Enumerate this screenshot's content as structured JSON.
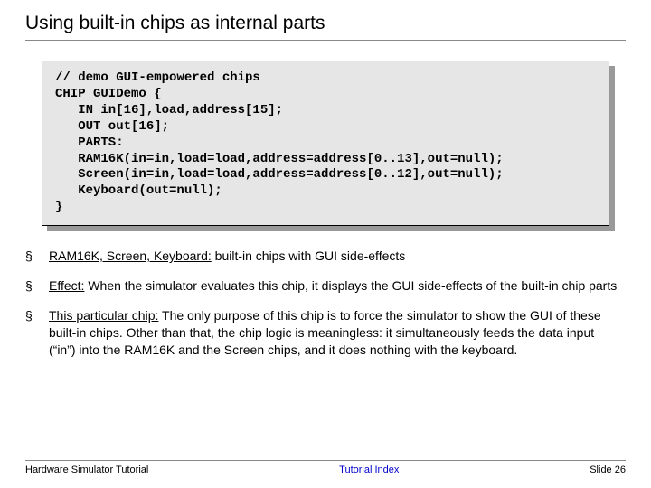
{
  "title": "Using built-in chips as internal parts",
  "code": "// demo GUI-empowered chips\nCHIP GUIDemo {\n   IN in[16],load,address[15];\n   OUT out[16];\n   PARTS:\n   RAM16K(in=in,load=load,address=address[0..13],out=null);\n   Screen(in=in,load=load,address=address[0..12],out=null);\n   Keyboard(out=null);\n}",
  "bullets": [
    {
      "label": "RAM16K, Screen, Keyboard:",
      "text": " built-in chips with GUI side-effects"
    },
    {
      "label": "Effect:",
      "text": " When the simulator evaluates this chip, it displays the GUI side-effects of the built-in chip parts"
    },
    {
      "label": "This particular chip:",
      "text": " The only purpose of this chip is to force the simulator to show the GUI of these built-in chips. Other than that, the chip logic is meaningless: it simultaneously feeds the data input (“in”) into the RAM16K and the Screen chips, and it does nothing with the keyboard."
    }
  ],
  "footer": {
    "left": "Hardware Simulator Tutorial",
    "center": "Tutorial Index",
    "right": "Slide 26"
  }
}
